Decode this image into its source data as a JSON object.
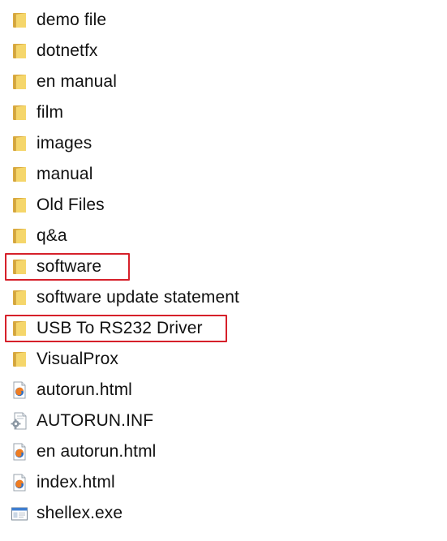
{
  "files": [
    {
      "label": "demo file",
      "type": "folder",
      "icon": "folder-icon",
      "highlighted": false
    },
    {
      "label": "dotnetfx",
      "type": "folder",
      "icon": "folder-icon",
      "highlighted": false
    },
    {
      "label": "en manual",
      "type": "folder",
      "icon": "folder-icon",
      "highlighted": false
    },
    {
      "label": "film",
      "type": "folder",
      "icon": "folder-icon",
      "highlighted": false
    },
    {
      "label": "images",
      "type": "folder",
      "icon": "folder-icon",
      "highlighted": false
    },
    {
      "label": "manual",
      "type": "folder",
      "icon": "folder-icon",
      "highlighted": false
    },
    {
      "label": "Old Files",
      "type": "folder",
      "icon": "folder-icon",
      "highlighted": false
    },
    {
      "label": "q&a",
      "type": "folder",
      "icon": "folder-icon",
      "highlighted": false
    },
    {
      "label": "software",
      "type": "folder",
      "icon": "folder-icon",
      "highlighted": true
    },
    {
      "label": "software update statement",
      "type": "folder",
      "icon": "folder-icon",
      "highlighted": false
    },
    {
      "label": "USB To RS232 Driver",
      "type": "folder",
      "icon": "folder-icon",
      "highlighted": true
    },
    {
      "label": "VisualProx",
      "type": "folder",
      "icon": "folder-icon",
      "highlighted": false
    },
    {
      "label": "autorun.html",
      "type": "html",
      "icon": "firefox-html-file-icon",
      "highlighted": false
    },
    {
      "label": "AUTORUN.INF",
      "type": "inf",
      "icon": "settings-file-icon",
      "highlighted": false
    },
    {
      "label": "en autorun.html",
      "type": "html",
      "icon": "firefox-html-file-icon",
      "highlighted": false
    },
    {
      "label": "index.html",
      "type": "html",
      "icon": "firefox-html-file-icon",
      "highlighted": false
    },
    {
      "label": "shellex.exe",
      "type": "exe",
      "icon": "application-window-icon",
      "highlighted": false
    }
  ],
  "colors": {
    "highlight_border": "#d6202a",
    "folder_back": "#d9a93f",
    "folder_front": "#f5d66b"
  }
}
